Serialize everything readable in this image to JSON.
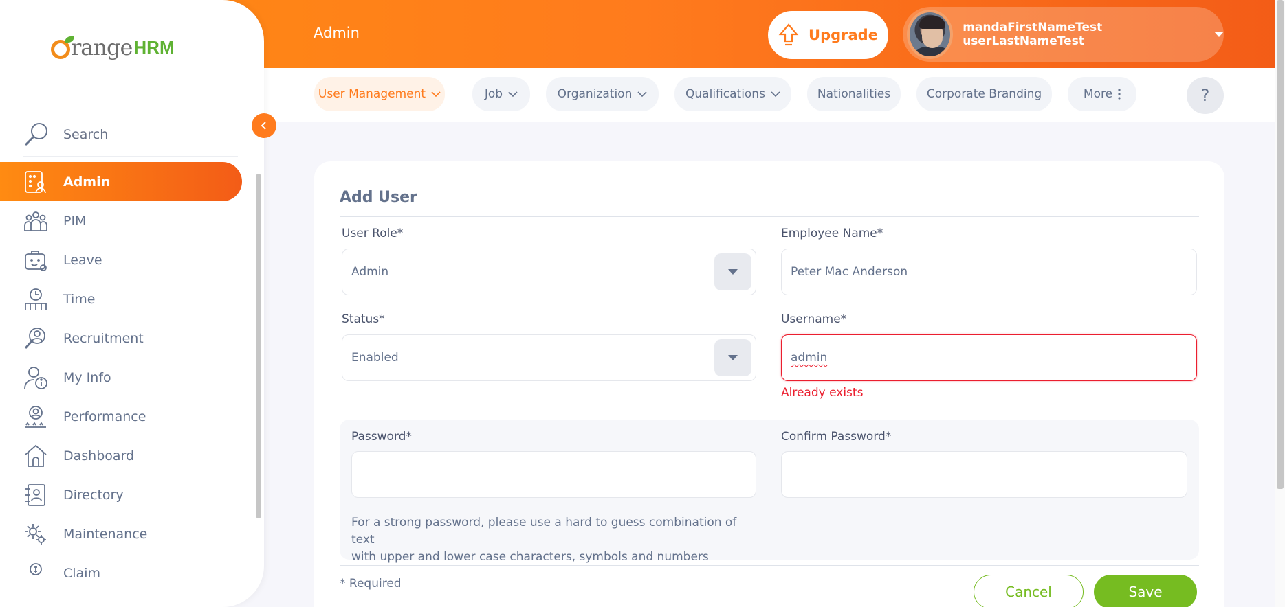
{
  "header": {
    "title": "Admin",
    "upgrade_label": "Upgrade",
    "user_name": "mandaFirstNameTest userLastNameTest"
  },
  "sidebar": {
    "logo_main": "range",
    "logo_hrm": "HRM",
    "search_label": "Search",
    "items": [
      {
        "label": "Admin",
        "icon": "admin-icon",
        "active": true
      },
      {
        "label": "PIM",
        "icon": "pim-icon"
      },
      {
        "label": "Leave",
        "icon": "leave-icon"
      },
      {
        "label": "Time",
        "icon": "time-icon"
      },
      {
        "label": "Recruitment",
        "icon": "recruitment-icon"
      },
      {
        "label": "My Info",
        "icon": "my-info-icon"
      },
      {
        "label": "Performance",
        "icon": "performance-icon"
      },
      {
        "label": "Dashboard",
        "icon": "dashboard-icon"
      },
      {
        "label": "Directory",
        "icon": "directory-icon"
      },
      {
        "label": "Maintenance",
        "icon": "maintenance-icon"
      },
      {
        "label": "Claim",
        "icon": "claim-icon"
      }
    ]
  },
  "tabs": [
    {
      "label": "User Management",
      "active": true,
      "dropdown": true
    },
    {
      "label": "Job",
      "dropdown": true
    },
    {
      "label": "Organization",
      "dropdown": true
    },
    {
      "label": "Qualifications",
      "dropdown": true
    },
    {
      "label": "Nationalities"
    },
    {
      "label": "Corporate Branding"
    },
    {
      "label": "More"
    }
  ],
  "help_label": "?",
  "form": {
    "title": "Add User",
    "user_role": {
      "label": "User Role*",
      "value": "Admin"
    },
    "employee_name": {
      "label": "Employee Name*",
      "value": "Peter Mac Anderson"
    },
    "status": {
      "label": "Status*",
      "value": "Enabled"
    },
    "username": {
      "label": "Username*",
      "value": "admin",
      "error": "Already exists"
    },
    "password": {
      "label": "Password*",
      "value": ""
    },
    "confirm_password": {
      "label": "Confirm Password*",
      "value": ""
    },
    "password_hint_line1": "For a strong password, please use a hard to guess combination of text",
    "password_hint_line2": "with upper and lower case characters, symbols and numbers",
    "required_note": "* Required",
    "cancel_label": "Cancel",
    "save_label": "Save"
  },
  "colors": {
    "brand_orange": "#ff7b1d",
    "save_green": "#76bc21",
    "error_red": "#eb1f2f"
  }
}
